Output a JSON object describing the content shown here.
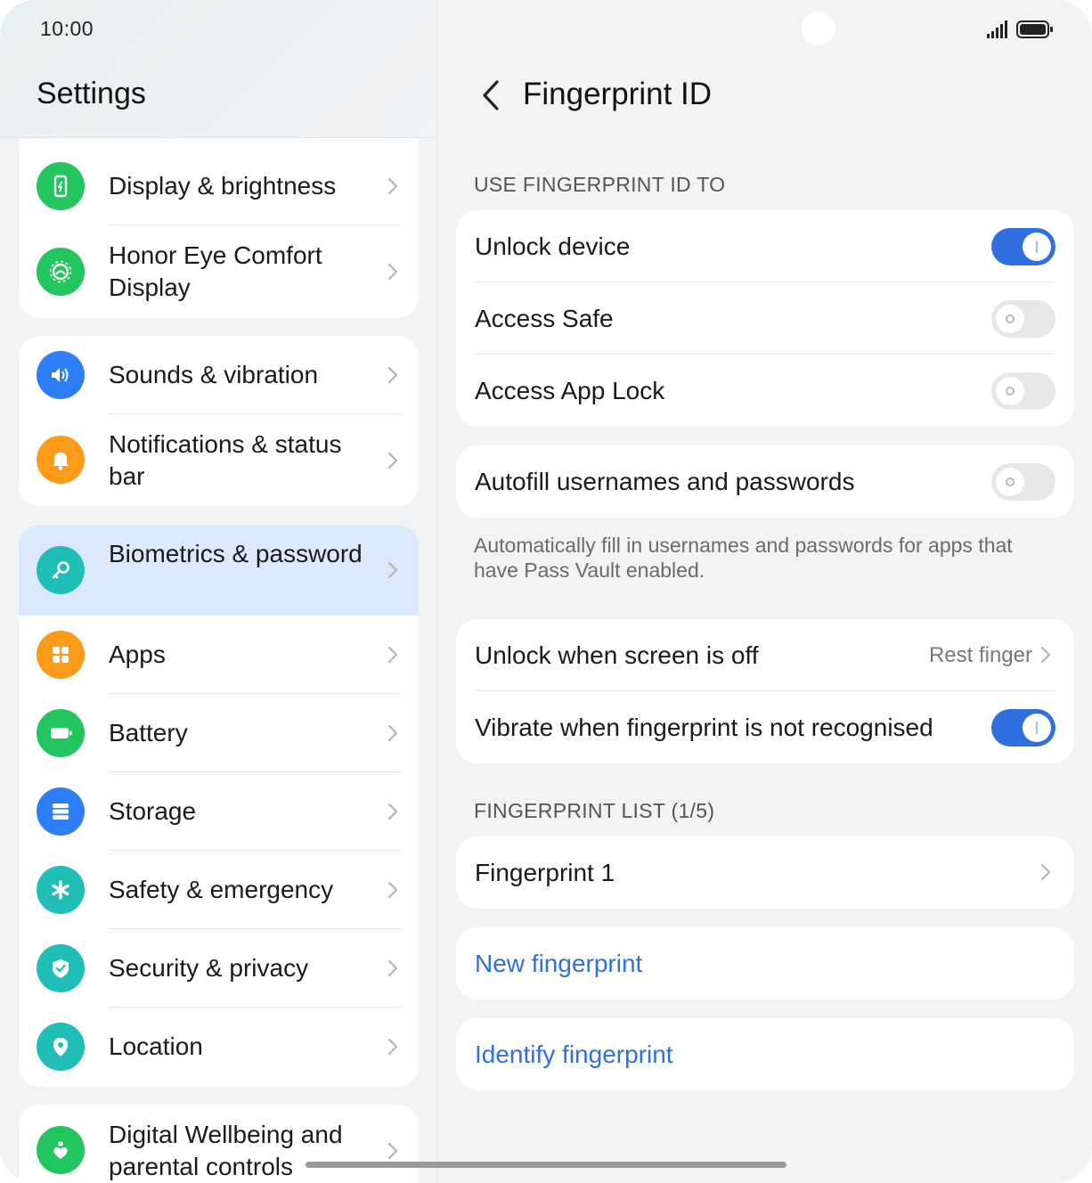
{
  "status_bar": {
    "time": "10:00"
  },
  "left_pane": {
    "title": "Settings",
    "groups": [
      {
        "items": [
          {
            "label": "Display & brightness",
            "icon": "display-brightness-icon",
            "color": "#22c55e",
            "active": false
          },
          {
            "label": "Honor Eye Comfort Display",
            "icon": "eye-comfort-icon",
            "color": "#22c55e",
            "active": false
          }
        ]
      },
      {
        "items": [
          {
            "label": "Sounds & vibration",
            "icon": "speaker-icon",
            "color": "#2d7ef7",
            "active": false
          },
          {
            "label": "Notifications & status bar",
            "icon": "bell-icon",
            "color": "#fb9b19",
            "active": false
          }
        ]
      },
      {
        "items": [
          {
            "label": "Biometrics & password",
            "icon": "key-icon",
            "color": "#1fbfb8",
            "active": true
          },
          {
            "label": "Apps",
            "icon": "apps-grid-icon",
            "color": "#fb9b19",
            "active": false
          },
          {
            "label": "Battery",
            "icon": "battery-icon",
            "color": "#22c55e",
            "active": false
          },
          {
            "label": "Storage",
            "icon": "storage-icon",
            "color": "#2d7ef7",
            "active": false
          },
          {
            "label": "Safety & emergency",
            "icon": "asterisk-icon",
            "color": "#1fbfb8",
            "active": false
          },
          {
            "label": "Security & privacy",
            "icon": "shield-icon",
            "color": "#1fbfb8",
            "active": false
          },
          {
            "label": "Location",
            "icon": "location-pin-icon",
            "color": "#1fbfb8",
            "active": false
          }
        ]
      },
      {
        "items": [
          {
            "label": "Digital Wellbeing and parental controls",
            "icon": "heart-icon",
            "color": "#22c55e",
            "active": false
          }
        ]
      }
    ]
  },
  "right_pane": {
    "title": "Fingerprint ID",
    "sections": {
      "use_fingerprint": "USE FINGERPRINT ID TO",
      "fingerprint_list": "FINGERPRINT LIST (1/5)"
    },
    "use_rows": [
      {
        "label": "Unlock device",
        "on": true
      },
      {
        "label": "Access Safe",
        "on": false
      },
      {
        "label": "Access App Lock",
        "on": false
      }
    ],
    "autofill": {
      "label": "Autofill usernames and passwords",
      "on": false
    },
    "autofill_note": "Automatically fill in usernames and passwords for apps that have Pass Vault enabled.",
    "unlock_screen_off": {
      "label": "Unlock when screen is off",
      "value": "Rest finger"
    },
    "vibrate": {
      "label": "Vibrate when fingerprint is not recognised",
      "on": true
    },
    "fingerprints": [
      {
        "label": "Fingerprint 1"
      }
    ],
    "new_fingerprint": "New fingerprint",
    "identify_fingerprint": "Identify fingerprint"
  },
  "colors": {
    "accent": "#2f6fe0",
    "active_item_bg": "#dce8fc",
    "background": "#f1f3f5"
  }
}
